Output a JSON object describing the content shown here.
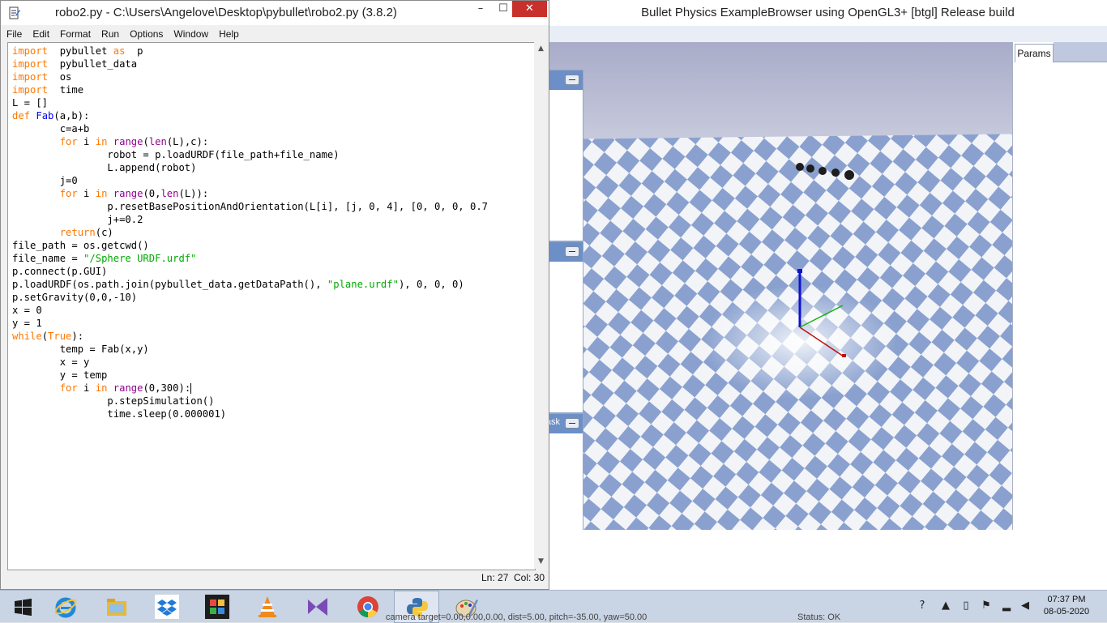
{
  "bullet": {
    "title": "Bullet Physics ExampleBrowser using OpenGL3+ [btgl] Release build",
    "params_tab": "Params",
    "panel3_label": "ask",
    "camera_status": "camera target=0.00,0.00,0.00, dist=5.00, pitch=-35.00, yaw=50.00",
    "status": "Status: OK"
  },
  "idle": {
    "title": "robo2.py - C:\\Users\\Angelove\\Desktop\\pybullet\\robo2.py (3.8.2)",
    "menu": [
      "File",
      "Edit",
      "Format",
      "Run",
      "Options",
      "Window",
      "Help"
    ],
    "window_buttons": {
      "minimize": "–",
      "maximize": "☐",
      "close": "✕"
    },
    "status_line": "Ln: 27",
    "status_col": "Col: 30",
    "code_lines": [
      [
        [
          "kw",
          "import"
        ],
        [
          "",
          "  pybullet "
        ],
        [
          "kw",
          "as"
        ],
        [
          "",
          "  p"
        ]
      ],
      [
        [
          "kw",
          "import"
        ],
        [
          "",
          "  pybullet_data"
        ]
      ],
      [
        [
          "kw",
          "import"
        ],
        [
          "",
          "  os"
        ]
      ],
      [
        [
          "kw",
          "import"
        ],
        [
          "",
          "  time"
        ]
      ],
      [
        [
          "",
          "L = []"
        ]
      ],
      [
        [
          "kw",
          "def"
        ],
        [
          "",
          " "
        ],
        [
          "fn",
          "Fab"
        ],
        [
          "",
          "(a,b):"
        ]
      ],
      [
        [
          "",
          "        c=a+b"
        ]
      ],
      [
        [
          "",
          "        "
        ],
        [
          "kw",
          "for"
        ],
        [
          "",
          " i "
        ],
        [
          "kw",
          "in"
        ],
        [
          "",
          " "
        ],
        [
          "bi",
          "range"
        ],
        [
          "",
          "("
        ],
        [
          "bi",
          "len"
        ],
        [
          "",
          "(L),c):"
        ]
      ],
      [
        [
          "",
          "                robot = p.loadURDF(file_path+file_name)"
        ]
      ],
      [
        [
          "",
          "                L.append(robot)"
        ]
      ],
      [
        [
          "",
          "        j=0"
        ]
      ],
      [
        [
          "",
          "        "
        ],
        [
          "kw",
          "for"
        ],
        [
          "",
          " i "
        ],
        [
          "kw",
          "in"
        ],
        [
          "",
          " "
        ],
        [
          "bi",
          "range"
        ],
        [
          "",
          "(0,"
        ],
        [
          "bi",
          "len"
        ],
        [
          "",
          "(L)):"
        ]
      ],
      [
        [
          "",
          "                p.resetBasePositionAndOrientation(L[i], [j, 0, 4], [0, 0, 0, 0.7"
        ]
      ],
      [
        [
          "",
          "                j+=0.2"
        ]
      ],
      [
        [
          "",
          "        "
        ],
        [
          "kw",
          "return"
        ],
        [
          "",
          "(c)"
        ]
      ],
      [
        [
          "",
          "file_path = os.getcwd()"
        ]
      ],
      [
        [
          "",
          "file_name = "
        ],
        [
          "st",
          "\"/Sphere URDF.urdf\""
        ]
      ],
      [
        [
          "",
          "p.connect(p.GUI)"
        ]
      ],
      [
        [
          "",
          "p.loadURDF(os.path.join(pybullet_data.getDataPath(), "
        ],
        [
          "st",
          "\"plane.urdf\""
        ],
        [
          "",
          "), 0, 0, 0)"
        ]
      ],
      [
        [
          "",
          "p.setGravity(0,0,-10)"
        ]
      ],
      [
        [
          "",
          "x = 0"
        ]
      ],
      [
        [
          "",
          "y = 1"
        ]
      ],
      [
        [
          "kw",
          "while"
        ],
        [
          "",
          "("
        ],
        [
          "kw",
          "True"
        ],
        [
          "",
          "):"
        ]
      ],
      [
        [
          "",
          "        temp = Fab(x,y)"
        ]
      ],
      [
        [
          "",
          "        x = y"
        ]
      ],
      [
        [
          "",
          "        y = temp"
        ]
      ],
      [
        [
          "",
          "        "
        ],
        [
          "kw",
          "for"
        ],
        [
          "",
          " i "
        ],
        [
          "kw",
          "in"
        ],
        [
          "",
          " "
        ],
        [
          "bi",
          "range"
        ],
        [
          "",
          "(0,300):"
        ],
        [
          "caret",
          ""
        ]
      ],
      [
        [
          "",
          "                p.stepSimulation()"
        ]
      ],
      [
        [
          "",
          "                time.sleep(0.000001)"
        ]
      ]
    ]
  },
  "taskbar": {
    "clock_time": "07:37 PM",
    "clock_date": "08-05-2020",
    "apps": [
      "start-button",
      "internet-explorer-icon",
      "file-explorer-icon",
      "dropbox-icon",
      "puzzle-app-icon",
      "vlc-icon",
      "visual-studio-icon",
      "chrome-icon",
      "python-idle-icon",
      "paint-icon"
    ]
  }
}
